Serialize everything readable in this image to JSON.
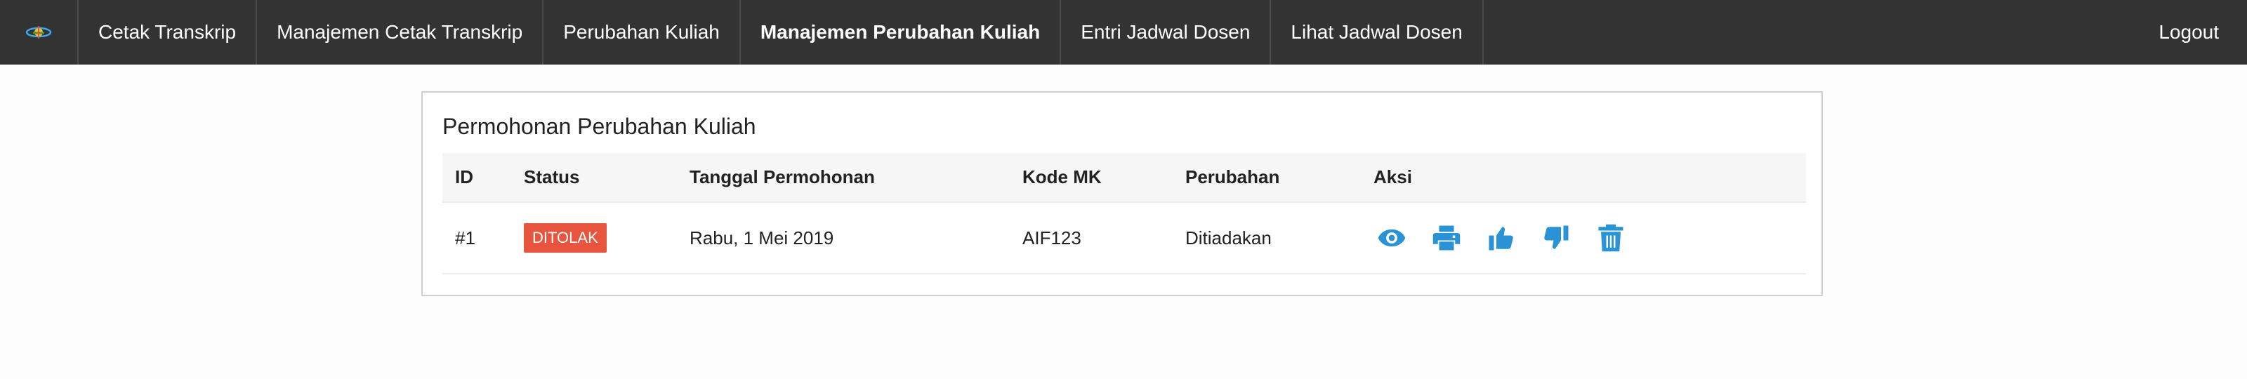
{
  "nav": {
    "logo_icon": "university-logo-icon",
    "items": [
      {
        "label": "Cetak Transkrip",
        "active": false
      },
      {
        "label": "Manajemen Cetak Transkrip",
        "active": false
      },
      {
        "label": "Perubahan Kuliah",
        "active": false
      },
      {
        "label": "Manajemen Perubahan Kuliah",
        "active": true
      },
      {
        "label": "Entri Jadwal Dosen",
        "active": false
      },
      {
        "label": "Lihat Jadwal Dosen",
        "active": false
      }
    ],
    "logout_label": "Logout"
  },
  "card": {
    "title": "Permohonan Perubahan Kuliah",
    "table": {
      "headers": [
        "ID",
        "Status",
        "Tanggal Permohonan",
        "Kode MK",
        "Perubahan",
        "Aksi"
      ],
      "rows": [
        {
          "id": "#1",
          "status": "DITOLAK",
          "tanggal": "Rabu, 1 Mei 2019",
          "kode_mk": "AIF123",
          "perubahan": "Ditiadakan",
          "actions": [
            "eye-icon",
            "print-icon",
            "thumbs-up-icon",
            "thumbs-down-icon",
            "trash-icon"
          ]
        }
      ]
    }
  },
  "colors": {
    "navbar_bg": "#333333",
    "accent_blue": "#2a93d5",
    "badge_rejected": "#e8553f"
  }
}
